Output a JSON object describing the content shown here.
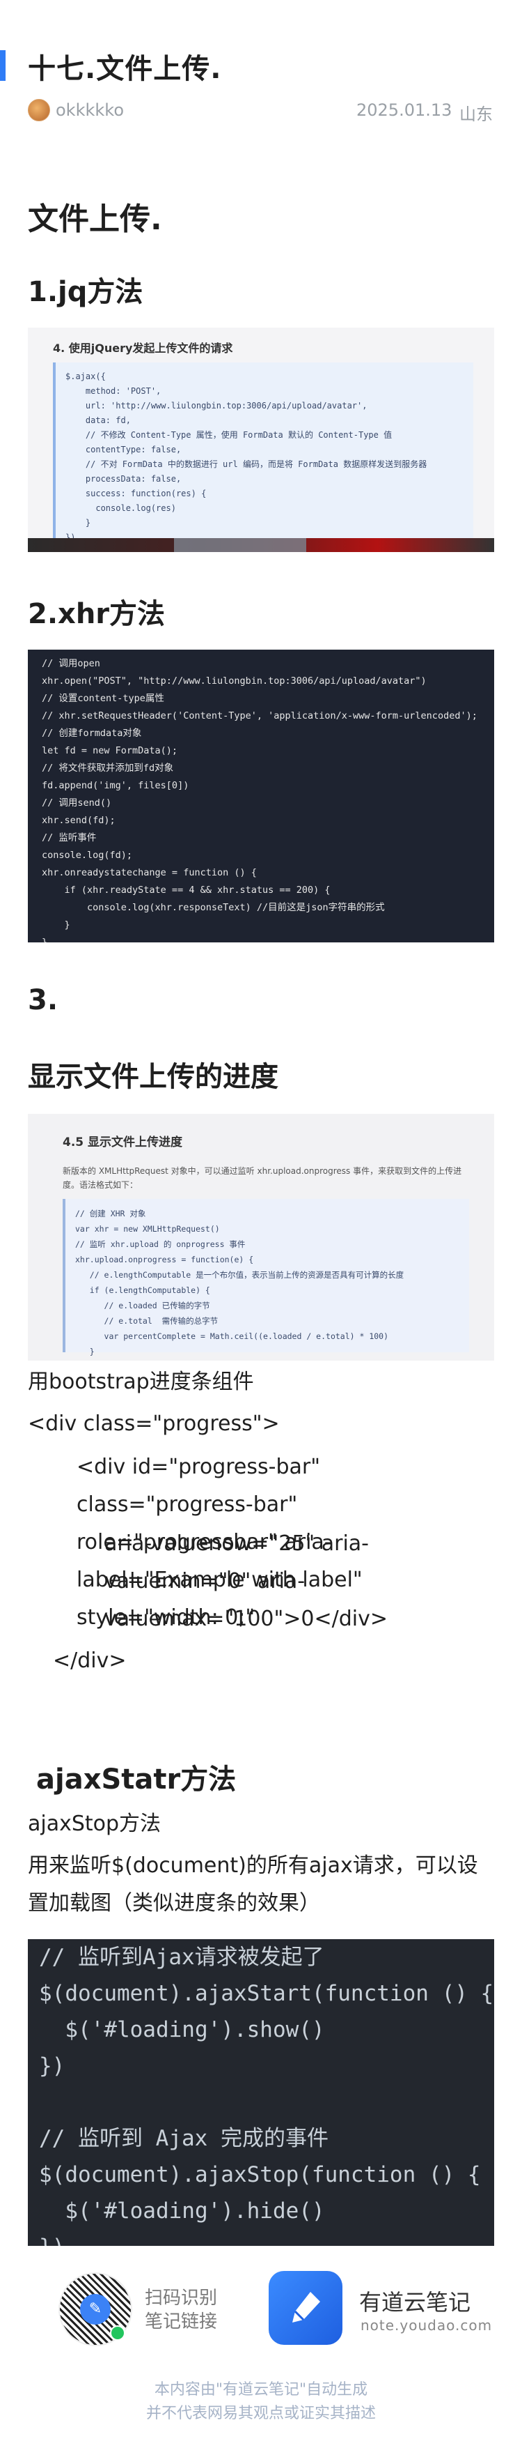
{
  "header": {
    "title": "十七.文件上传.",
    "author": "okkkkko",
    "date": "2025.01.13",
    "location": "山东"
  },
  "sections": {
    "main_heading": "文件上传.",
    "jq_heading": "1.jq方法",
    "xhr_heading": "2.xhr方法",
    "step3_heading": "3.",
    "progress_heading": "显示文件上传的进度",
    "ajax_heading": "ajaxStatr方法"
  },
  "shot1": {
    "caption": "4. 使用jQuery发起上传文件的请求",
    "code": "$.ajax({\n    method: 'POST',\n    url: 'http://www.liulongbin.top:3006/api/upload/avatar',\n    data: fd,\n    // 不修改 Content-Type 属性，使用 FormData 默认的 Content-Type 值\n    contentType: false,\n    // 不对 FormData 中的数据进行 url 编码，而是将 FormData 数据原样发送到服务器\n    processData: false,\n    success: function(res) {\n      console.log(res)\n    }\n})"
  },
  "shot2": {
    "code": "// 调用open\nxhr.open(\"POST\", \"http://www.liulongbin.top:3006/api/upload/avatar\")\n// 设置content-type属性\n// xhr.setRequestHeader('Content-Type', 'application/x-www-form-urlencoded');\n// 创建formdata对象\nlet fd = new FormData();\n// 将文件获取并添加到fd对象\nfd.append('img', files[0])\n// 调用send()\nxhr.send(fd);\n// 监听事件\nconsole.log(fd);\nxhr.onreadystatechange = function () {\n    if (xhr.readyState == 4 && xhr.status == 200) {\n        console.log(xhr.responseText) //目前这是json字符串的形式\n    }\n}\nxhr.upload.onload = function () {\n    let progress = document.querySelector(\"#progress-bar\");\n    progress.className = \"progress-bar bg-success\";"
  },
  "shot3": {
    "caption": "4.5 显示文件上传进度",
    "desc": "新版本的 XMLHttpRequest 对象中，可以通过监听 xhr.upload.onprogress 事件，来获取到文件的上传进度。语法格式如下：",
    "code": "// 创建 XHR 对象\nvar xhr = new XMLHttpRequest()\n// 监听 xhr.upload 的 onprogress 事件\nxhr.upload.onprogress = function(e) {\n   // e.lengthComputable 是一个布尔值，表示当前上传的资源是否具有可计算的长度\n   if (e.lengthComputable) {\n      // e.loaded 已传输的字节\n      // e.total  需传输的总字节\n      var percentComplete = Math.ceil((e.loaded / e.total) * 100)\n   }\n}"
  },
  "paragraphs": {
    "p1": "用bootstrap进度条组件",
    "p2": "<div class=\"progress\">",
    "p3": "<div id=\"progress-bar\" class=\"progress-bar\" role=\"progressbar\" aria-label=\"Example with label\" style=\"width: 0;\"",
    "p4": "aria-valuenow=\"25\" aria-valuemin=\"0\" aria-valuemax=\"100\">0</div>",
    "p5": "</div>",
    "p6": "ajaxStop方法",
    "p7": "用来监听$(document)的所有ajax请求，可以设置加载图（类似进度条的效果）"
  },
  "shot4": {
    "code": "// 监听到Ajax请求被发起了\n$(document).ajaxStart(function () {\n  $('#loading').show()\n})\n\n// 监听到 Ajax 完成的事件\n$(document).ajaxStop(function () {\n  $('#loading').hide()\n})"
  },
  "footer": {
    "scan_line1": "扫码识别",
    "scan_line2": "笔记链接",
    "app_name": "有道云笔记",
    "app_url": "note.youdao.com",
    "disclaimer1": "本内容由\"有道云笔记\"自动生成",
    "disclaimer2": "并不代表网易其观点或证实其描述"
  },
  "colors": {
    "accent": "#2f7cf6",
    "meta_gray": "#9aa0a6",
    "brand_blue": "#1e5fe0"
  }
}
